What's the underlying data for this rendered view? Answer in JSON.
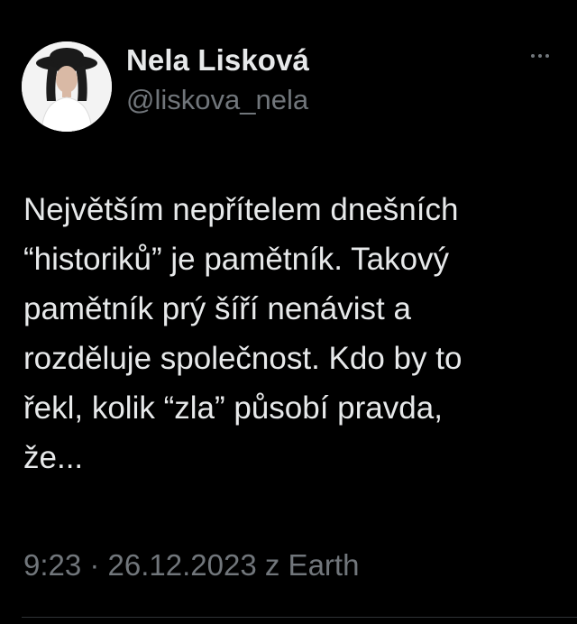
{
  "author": {
    "display_name": "Nela Lisková",
    "handle": "@liskova_nela",
    "avatar_icon": "profile-photo"
  },
  "header": {
    "more_icon": "more-horizontal-icon"
  },
  "tweet": {
    "lines": [
      "Největším nepřítelem dnešních",
      "“historiků” je pamětník. Takový",
      "pamětník prý šíří nenávist a",
      "rozděluje společnost. Kdo by to",
      "řekl, kolik “zla” působí pravda,",
      "že..."
    ],
    "timestamp": "9:23 · 26.12.2023 z Earth"
  },
  "colors": {
    "background": "#000000",
    "primary_text": "#e7e9ea",
    "secondary_text": "#71767b",
    "divider": "#2f3336"
  }
}
